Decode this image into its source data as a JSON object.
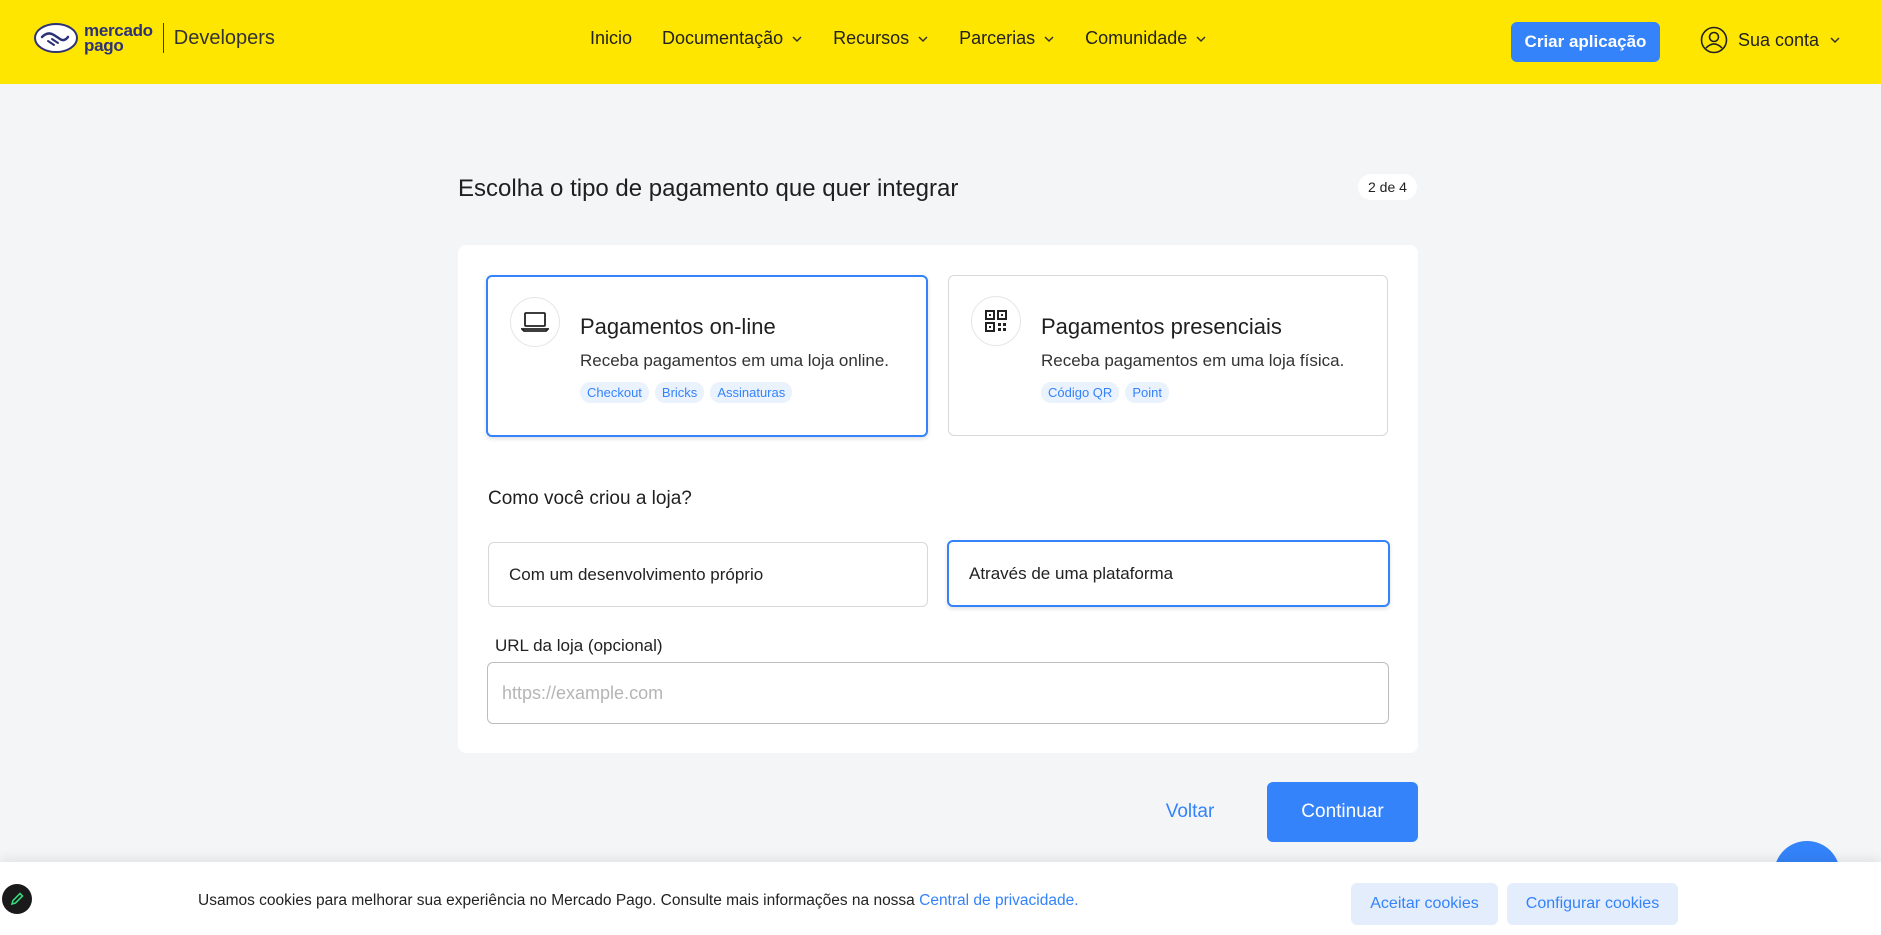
{
  "header": {
    "logo_line1": "mercado",
    "logo_line2": "pago",
    "logo_product": "Developers",
    "nav": [
      {
        "label": "Inicio",
        "has_menu": false
      },
      {
        "label": "Documentação",
        "has_menu": true
      },
      {
        "label": "Recursos",
        "has_menu": true
      },
      {
        "label": "Parcerias",
        "has_menu": true
      },
      {
        "label": "Comunidade",
        "has_menu": true
      }
    ],
    "create_app_label": "Criar aplicação",
    "account_label": "Sua conta",
    "brand_color": "#ffe600",
    "accent_color": "#3483fa"
  },
  "main": {
    "title": "Escolha o tipo de pagamento que quer integrar",
    "step": "2 de 4",
    "payment_types": [
      {
        "title": "Pagamentos on-line",
        "description": "Receba pagamentos em uma loja online.",
        "tags": [
          "Checkout",
          "Bricks",
          "Assinaturas"
        ],
        "icon": "laptop-icon",
        "selected": true
      },
      {
        "title": "Pagamentos presenciais",
        "description": "Receba pagamentos em uma loja física.",
        "tags": [
          "Código QR",
          "Point"
        ],
        "icon": "qr-code-icon",
        "selected": false
      }
    ],
    "store_question": "Como você criou a loja?",
    "store_options": [
      {
        "label": "Com um desenvolvimento próprio",
        "selected": false
      },
      {
        "label": "Através de uma plataforma",
        "selected": true
      }
    ],
    "url_label": "URL da loja (opcional)",
    "url_placeholder": "https://example.com",
    "url_value": "",
    "back_label": "Voltar",
    "continue_label": "Continuar"
  },
  "cookie": {
    "text": "Usamos cookies para melhorar sua experiência no Mercado Pago. Consulte mais informações na nossa ",
    "link_label": "Central de privacidade.",
    "accept_label": "Aceitar cookies",
    "configure_label": "Configurar cookies"
  }
}
